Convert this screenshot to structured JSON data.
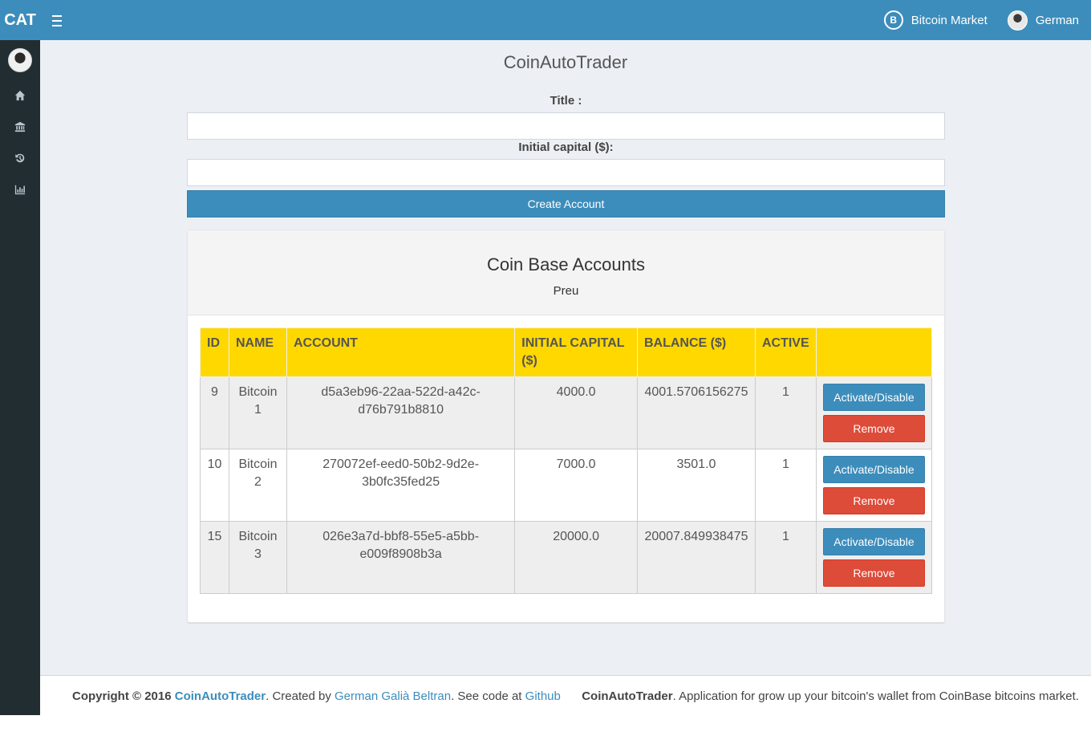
{
  "header": {
    "brand": "CAT",
    "market_label": "Bitcoin Market",
    "user_name": "German"
  },
  "sidebar": {
    "items": [
      {
        "icon": "home-icon"
      },
      {
        "icon": "bank-icon"
      },
      {
        "icon": "history-icon"
      },
      {
        "icon": "bar-chart-icon"
      }
    ]
  },
  "main": {
    "app_title": "CoinAutoTrader",
    "form": {
      "title_label": "Title :",
      "title_value": "",
      "capital_label": "Initial capital ($):",
      "capital_value": "",
      "create_button": "Create Account"
    },
    "accounts_box": {
      "title": "Coin Base Accounts",
      "subtitle": "Preu",
      "columns": [
        "ID",
        "NAME",
        "ACCOUNT",
        "INITIAL CAPITAL ($)",
        "BALANCE ($)",
        "ACTIVE",
        ""
      ],
      "rows": [
        {
          "id": "9",
          "name": "Bitcoin 1",
          "account": "d5a3eb96-22aa-522d-a42c-d76b791b8810",
          "initial_capital": "4000.0",
          "balance": "4001.5706156275",
          "active": "1",
          "activate_label": "Activate/Disable",
          "remove_label": "Remove"
        },
        {
          "id": "10",
          "name": "Bitcoin 2",
          "account": "270072ef-eed0-50b2-9d2e-3b0fc35fed25",
          "initial_capital": "7000.0",
          "balance": "3501.0",
          "active": "1",
          "activate_label": "Activate/Disable",
          "remove_label": "Remove"
        },
        {
          "id": "15",
          "name": "Bitcoin 3",
          "account": "026e3a7d-bbf8-55e5-a5bb-e009f8908b3a",
          "initial_capital": "20000.0",
          "balance": "20007.849938475",
          "active": "1",
          "activate_label": "Activate/Disable",
          "remove_label": "Remove"
        }
      ]
    }
  },
  "footer": {
    "copyright": "Copyright © 2016",
    "app_link": "CoinAutoTrader",
    "created_by": ". Created by",
    "author_link": "German Galià Beltran",
    "see_code": ". See code at",
    "github_link": "Github",
    "right_app": "CoinAutoTrader",
    "right_text": ". Application for grow up your bitcoin's wallet from CoinBase bitcoins market."
  },
  "colors": {
    "primary": "#3c8dbc",
    "sidebar": "#222d32",
    "table_header": "#ffd800",
    "danger": "#dd4b39"
  }
}
